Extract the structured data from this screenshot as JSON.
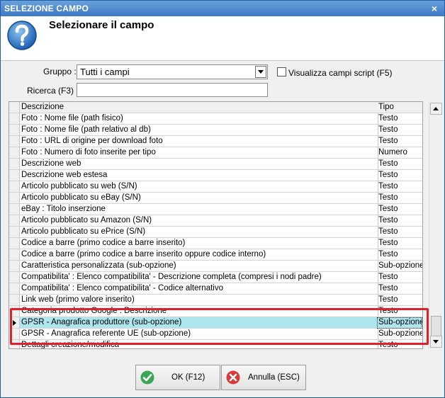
{
  "window": {
    "title": "SELEZIONE CAMPO",
    "close_label": "×"
  },
  "header": {
    "title": "Selezionare il campo"
  },
  "filters": {
    "gruppo_label": "Gruppo :",
    "gruppo_value": "Tutti i campi",
    "visualizza_label": "Visualizza campi script (F5)",
    "ricerca_label": "Ricerca (F3) :",
    "ricerca_value": ""
  },
  "grid": {
    "columns": [
      "Descrizione",
      "Tipo"
    ],
    "rows": [
      [
        "Foto : Nome file (path fisico)",
        "Testo"
      ],
      [
        "Foto : Nome file (path relativo al db)",
        "Testo"
      ],
      [
        "Foto : URL di origine per download foto",
        "Testo"
      ],
      [
        "Foto : Numero di foto inserite per tipo",
        "Numero"
      ],
      [
        "Descrizione web",
        "Testo"
      ],
      [
        "Descrizione web estesa",
        "Testo"
      ],
      [
        "Articolo pubblicato su web (S/N)",
        "Testo"
      ],
      [
        "Articolo pubblicato su eBay (S/N)",
        "Testo"
      ],
      [
        "eBay : Titolo inserzione",
        "Testo"
      ],
      [
        "Articolo pubblicato su Amazon (S/N)",
        "Testo"
      ],
      [
        "Articolo pubblicato su ePrice (S/N)",
        "Testo"
      ],
      [
        "Codice a barre (primo codice a barre inserito)",
        "Testo"
      ],
      [
        "Codice a barre (primo codice a barre inserito oppure codice interno)",
        "Testo"
      ],
      [
        "Caratteristica personalizzata (sub-opzione)",
        "Sub-opzione"
      ],
      [
        "Compatibilita' : Elenco compatibilita' - Descrizione completa (compresi i nodi padre)",
        "Testo"
      ],
      [
        "Compatibilita' : Elenco compatibilita' - Codice alternativo",
        "Testo"
      ],
      [
        "Link web (primo valore inserito)",
        "Testo"
      ],
      [
        "Categoria prodotto Google : Descrizione",
        "Testo"
      ],
      [
        "GPSR - Anagrafica produttore (sub-opzione)",
        "Sub-opzione"
      ],
      [
        "GPSR - Anagrafica referente UE (sub-opzione)",
        "Sub-opzione"
      ],
      [
        "Dettagli creazione/modifica",
        "Testo"
      ]
    ],
    "selected_index": 18
  },
  "buttons": {
    "ok_label": "OK (F12)",
    "cancel_label": "Annulla (ESC)"
  },
  "colors": {
    "title_bar": "#3b79c4",
    "selection": "#aee6ee",
    "highlight_box": "#e0202a",
    "ok_icon": "#3aa655",
    "cancel_icon": "#d93a3a"
  }
}
